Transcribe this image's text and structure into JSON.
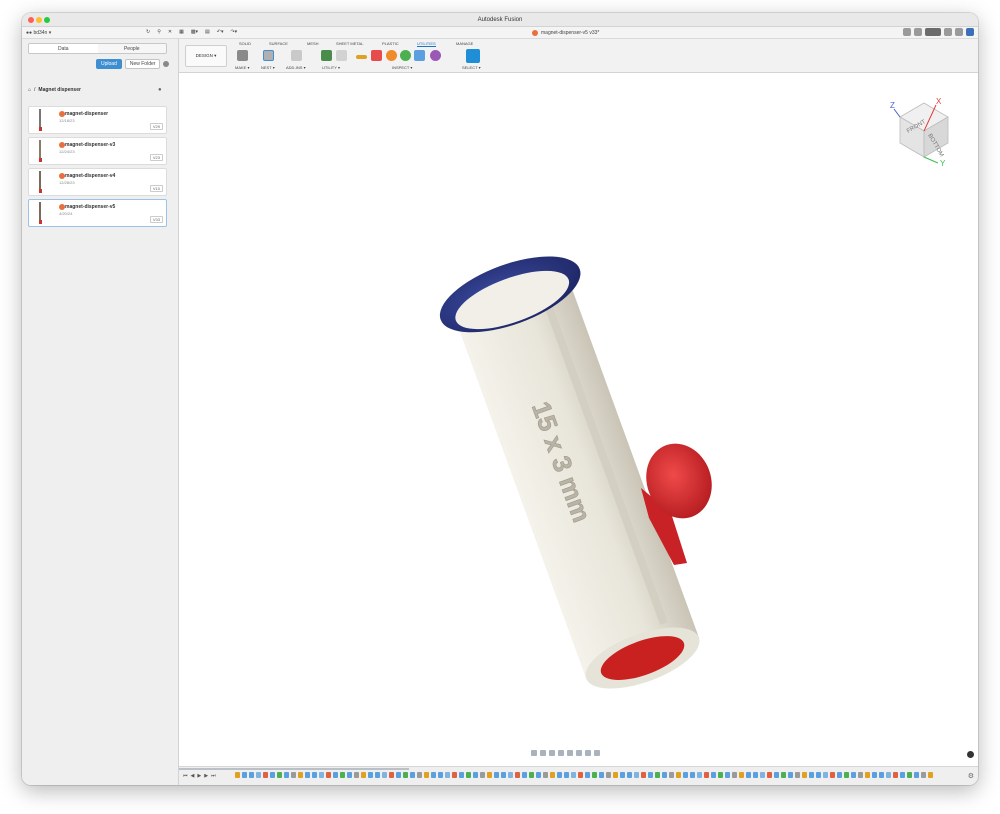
{
  "window": {
    "title": "Autodesk Fusion"
  },
  "tabbar": {
    "user": "bd34n",
    "document_tab": "magnet-dispenser-v5 v33*"
  },
  "data_panel": {
    "tab_data": "Data",
    "tab_people": "People",
    "upload_label": "Upload",
    "new_folder_label": "New Folder",
    "breadcrumb": "Magnet dispenser",
    "files": [
      {
        "name": "magnet-dispenser",
        "date": "12/18/23",
        "version": "V29"
      },
      {
        "name": "magnet-dispenser-v3",
        "date": "12/24/23",
        "version": "V23"
      },
      {
        "name": "magnet-dispenser-v4",
        "date": "12/28/23",
        "version": "V10"
      },
      {
        "name": "magnet-dispenser-v5",
        "date": "4/20/24",
        "version": "V33"
      }
    ]
  },
  "toolbar": {
    "workspace": "DESIGN",
    "tabs": [
      "SOLID",
      "SURFACE",
      "MESH",
      "SHEET METAL",
      "PLASTIC",
      "UTILITIES",
      "MANAGE"
    ],
    "active_tab": "UTILITIES",
    "groups": [
      "MAKE",
      "NEST",
      "ADD-INS",
      "UTILITY",
      "INSPECT",
      "SELECT"
    ]
  },
  "viewcube": {
    "front": "FRONT",
    "bottom": "BOTTOM",
    "x": "X",
    "y": "Y",
    "z": "Z"
  },
  "model": {
    "embossed_text": "15 x 3 mm",
    "body_color": "#eae7dc",
    "cap_color": "#2b3a8a",
    "lever_color": "#d6262b"
  }
}
